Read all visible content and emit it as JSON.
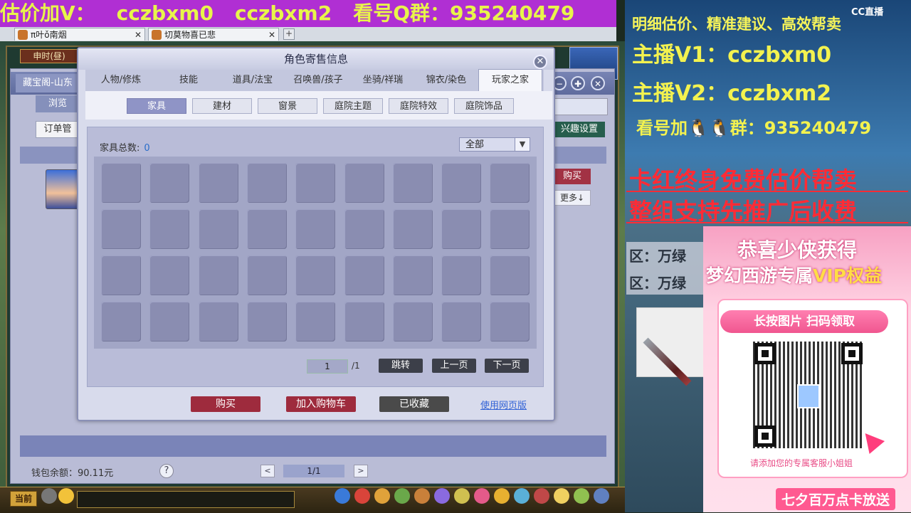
{
  "banner": {
    "part1": "估价加V：",
    "part2": "cczbxm0",
    "part3": "cczbxm2",
    "part4": "看号Q群：",
    "part5": "935240479"
  },
  "browser_tabs": [
    {
      "label": "π叶ǒ南烟"
    },
    {
      "label": "切莫物喜已悲"
    }
  ],
  "game": {
    "time_label": "申时(昼)",
    "bottom_current": "当前"
  },
  "bg_window": {
    "tab_label": "藏宝阁-山东",
    "browse_label": "浏览",
    "order_label": "订单管",
    "interest_settings": "兴趣设置",
    "buy_label": "购买",
    "more_label": "更多↓",
    "wallet": "钱包余额：90.11元",
    "help": "?",
    "page": "1/1",
    "prev": "<",
    "next": ">",
    "win_min": "−",
    "win_max": "✚",
    "win_close": "✕"
  },
  "dialog": {
    "title": "角色寄售信息",
    "close": "✕",
    "main_tabs": [
      "人物/修炼",
      "技能",
      "道具/法宝",
      "召唤兽/孩子",
      "坐骑/祥瑞",
      "锦衣/染色",
      "玩家之家"
    ],
    "active_main_tab": 6,
    "sub_tabs": [
      "家具",
      "建材",
      "窗景",
      "庭院主题",
      "庭院特效",
      "庭院饰品"
    ],
    "active_sub_tab": 0,
    "count_label": "家具总数:",
    "count_value": "0",
    "filter_value": "全部",
    "grid_rows": 4,
    "grid_cols": 9,
    "page_input": "1",
    "page_total": "/1",
    "jump": "跳转",
    "prev_page": "上一页",
    "next_page": "下一页",
    "buy": "购买",
    "add_cart": "加入购物车",
    "collected": "已收藏",
    "web_version": "使用网页版",
    "colors": {
      "buy": "#9e2b3d",
      "cart": "#9e2b3d",
      "collected": "#4a4a4a"
    }
  },
  "stream_overlay": {
    "platform": "CC直播",
    "line1": "明细估价、精准建议、高效帮卖",
    "line2": "主播V1：cczbxm0",
    "line3": "主播V2：cczbxm2",
    "line4": "看号加🐧🐧群：935240479",
    "line5": "卡红终身免费估价帮卖",
    "line6": "整组支持先推广后收费",
    "region1": "区：万绿",
    "region2": "区：万绿",
    "vip_title": "恭喜少侠获得",
    "vip_sub_a": "梦幻西游专属",
    "vip_sub_b": "VIP权益",
    "vip_bar": "长按图片 扫码领取",
    "vip_hint": "请添加您的专属客服小姐姐",
    "vip_bottom": "七夕百万点卡放送"
  }
}
